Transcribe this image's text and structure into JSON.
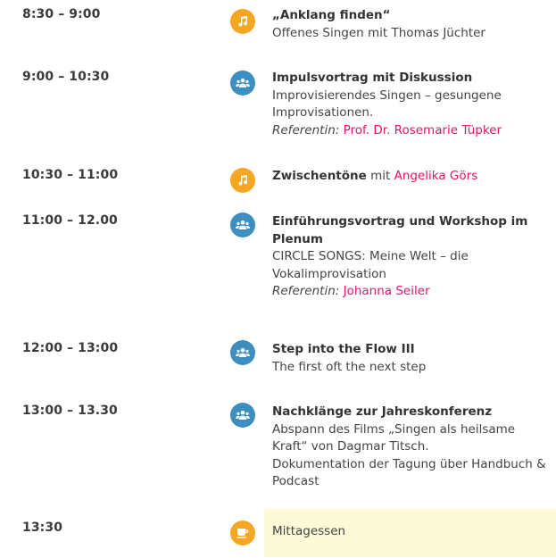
{
  "schedule": [
    {
      "time": "8:30 – 9:00",
      "icon": "music-note-icon",
      "title": "„Anklang finden“",
      "lines": [
        "Offenes Singen mit Thomas Jüchter"
      ]
    },
    {
      "time": "9:00 – 10:30",
      "icon": "group-icon",
      "title": "Impulsvortrag mit Diskussion",
      "lines": [
        "Improvisierendes Singen – gesungene",
        "Improvisationen."
      ],
      "ref_label": "Referentin:",
      "ref_name": "Prof. Dr. Rosemarie Tüpker"
    },
    {
      "time": "10:30 – 11:00",
      "icon": "music-note-icon",
      "title": "Zwischentöne",
      "mid": "mit",
      "person": "Angelika Görs"
    },
    {
      "time": "11:00 – 12.00",
      "icon": "group-icon",
      "title": "Einführungsvortrag und Workshop im Plenum",
      "lines": [
        "CIRCLE SONGS: Meine Welt – die",
        "Vokalimprovisation"
      ],
      "ref_label": "Referentin:",
      "ref_name": "Johanna Seiler"
    },
    {
      "time": "12:00 – 13:00",
      "icon": "group-icon",
      "title": "Step into the Flow III",
      "lines": [
        "The first oft the next step"
      ]
    },
    {
      "time": "13:00 – 13.30",
      "icon": "group-icon",
      "title": "Nachklänge zur Jahreskonferenz",
      "lines": [
        "Abspann des Films „Singen als heilsame",
        "Kraft“ von Dagmar Titsch.",
        "Dokumentation der Tagung über Handbuch &",
        "Podcast"
      ]
    },
    {
      "time": "13:30",
      "icon": "coffee-icon",
      "title": "Mittagessen"
    }
  ],
  "colors": {
    "orange": "#f5a623",
    "blue": "#3d8fc2",
    "pink": "#e5136b",
    "highlight": "#fcfad7"
  }
}
